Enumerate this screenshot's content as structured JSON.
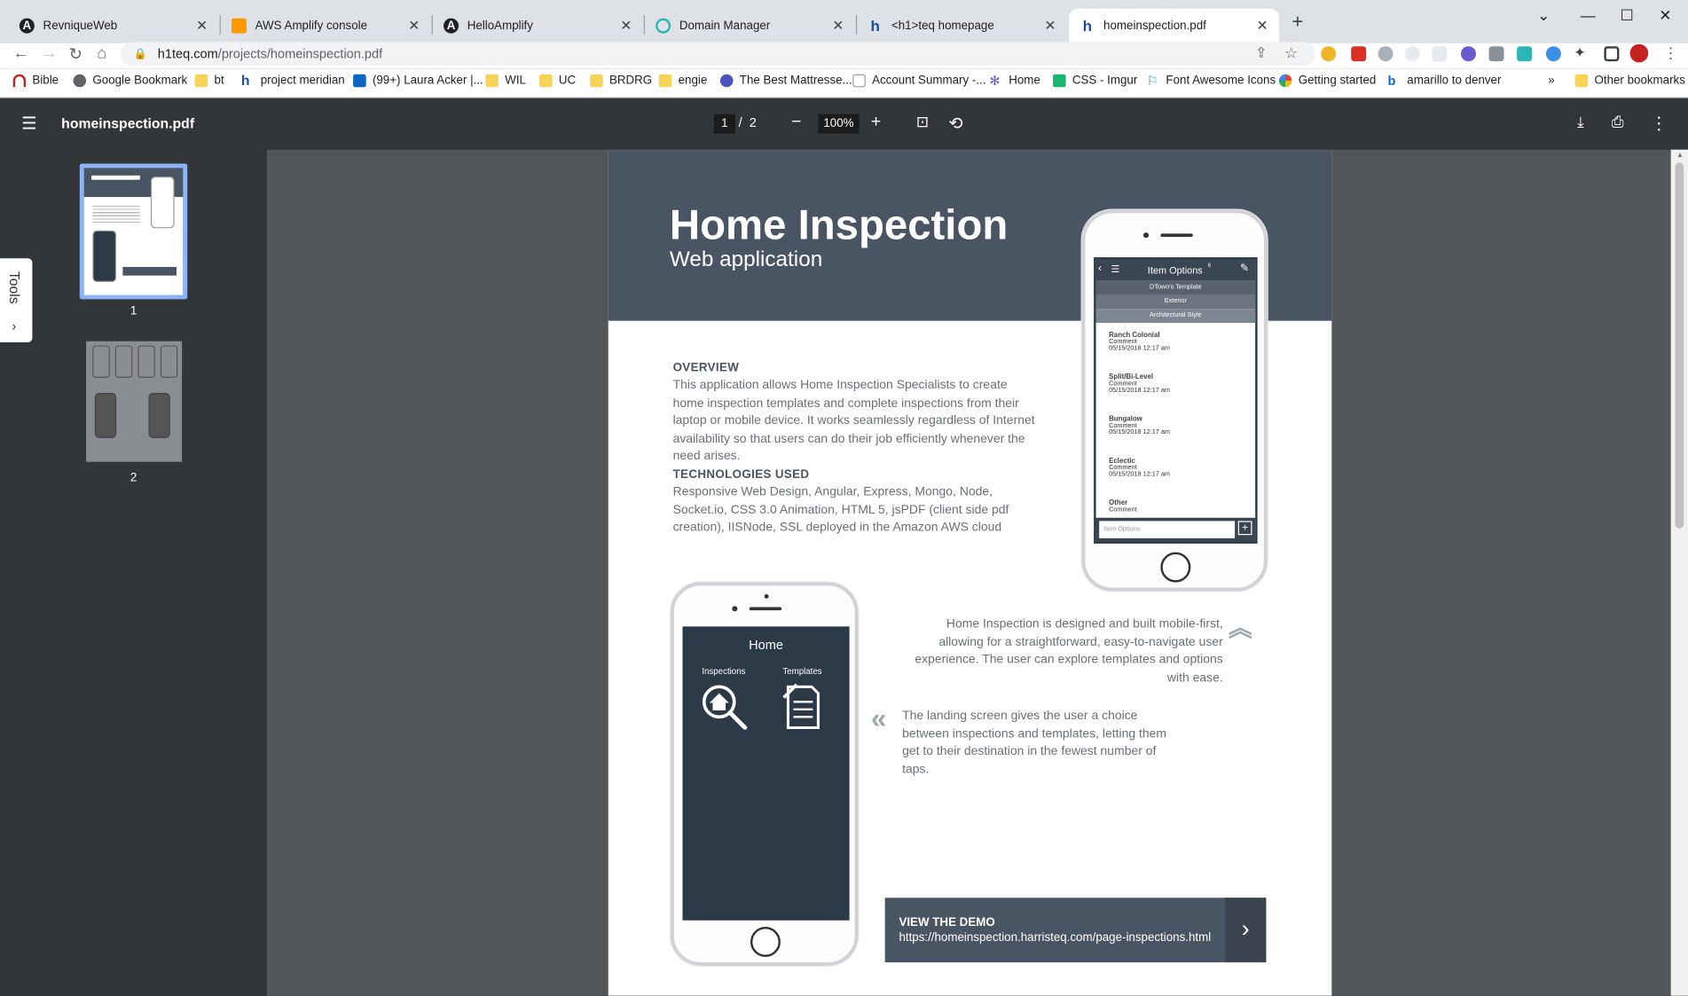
{
  "tabs": [
    {
      "title": "RevniqueWeb",
      "favicon": "angular-icon"
    },
    {
      "title": "AWS Amplify console",
      "favicon": "aws-icon"
    },
    {
      "title": "HelloAmplify",
      "favicon": "angular-icon"
    },
    {
      "title": "Domain Manager",
      "favicon": "domain-icon"
    },
    {
      "title": "<h1>teq homepage",
      "favicon": "h1teq-icon"
    },
    {
      "title": "homeinspection.pdf",
      "favicon": "h1teq-icon",
      "active": true
    }
  ],
  "address": {
    "host": "h1teq.com",
    "path": "/projects/homeinspection.pdf"
  },
  "bookmarks": [
    "Bible",
    "Google Bookmark",
    "bt",
    "project meridian",
    "(99+) Laura Acker |...",
    "WIL",
    "UC",
    "BRDRG",
    "engie",
    "The Best Mattresse...",
    "Account Summary -...",
    "Home",
    "CSS - Imgur",
    "Font Awesome Icons",
    "Getting started",
    "amarillo to denver"
  ],
  "bookmarks_more": "»",
  "other_bookmarks": "Other bookmarks",
  "pdf": {
    "filename": "homeinspection.pdf",
    "page_current": "1",
    "page_total": "2",
    "page_sep": "/",
    "zoom": "100%",
    "tools_label": "Tools",
    "thumbnails": [
      "1",
      "2"
    ]
  },
  "document": {
    "title": "Home Inspection",
    "subtitle": "Web application",
    "overview_heading": "OVERVIEW",
    "overview_text": "This application allows Home Inspection Specialists to create home inspection templates and complete inspections from their laptop or mobile device. It works seamlessly regardless of Internet availability so that users can do their job efficiently whenever the need arises.",
    "tech_heading": "TECHNOLOGIES USED",
    "tech_text": "Responsive Web Design, Angular, Express, Mongo, Node, Socket.io, CSS 3.0 Animation, HTML 5, jsPDF (client side pdf creation), IISNode, SSL deployed in the Amazon AWS cloud",
    "mobile_first_text": "Home Inspection is designed and built mobile-first, allowing for a straightforward, easy-to-navigate user experience. The user can explore templates and options with ease.",
    "landing_text": "The landing screen gives the user a choice between inspections and templates, letting them get to their destination in the fewest number of taps.",
    "demo_label": "VIEW THE DEMO",
    "demo_url": "https://homeinspection.harristeq.com/page-inspections.html",
    "phone_home": {
      "title": "Home",
      "inspections": "Inspections",
      "templates": "Templates"
    },
    "phone_options": {
      "title": "Item Options",
      "badge": "6",
      "breadcrumbs": [
        "DTown's Template",
        "Exterior",
        "Architectural Style"
      ],
      "items": [
        {
          "name": "Ranch Colonial",
          "sub": "Comment",
          "date": "05/15/2018  12:17 am"
        },
        {
          "name": "Split/Bi-Level",
          "sub": "Comment",
          "date": "05/15/2018  12:17 am"
        },
        {
          "name": "Bungalow",
          "sub": "Comment",
          "date": "05/15/2018  12:17 am"
        },
        {
          "name": "Eclectic",
          "sub": "Comment",
          "date": "05/15/2018  12:17 am"
        },
        {
          "name": "Other",
          "sub": "Comment",
          "date": ""
        }
      ],
      "input_placeholder": "Item Options"
    }
  }
}
